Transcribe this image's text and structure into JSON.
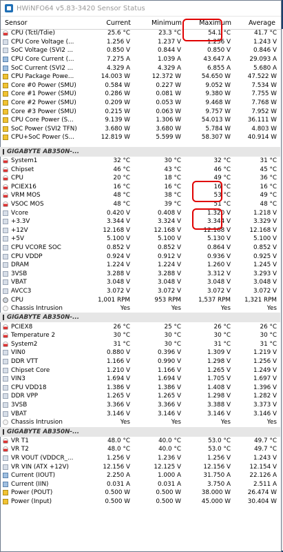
{
  "window": {
    "title": "HWiNFO64 v5.83-3420 Sensor Status"
  },
  "columns": [
    "Sensor",
    "Current",
    "Minimum",
    "Maximum",
    "Average"
  ],
  "rows": [
    {
      "type": "data",
      "icon": "temp",
      "label": "CPU (Tctl/Tdie)",
      "cur": "25.6 °C",
      "min": "23.3 °C",
      "max": "54.1 °C",
      "avg": "41.7 °C"
    },
    {
      "type": "data",
      "icon": "volt",
      "label": "CPU Core Voltage (...",
      "cur": "1.256 V",
      "min": "1.237 V",
      "max": "1.256 V",
      "avg": "1.243 V"
    },
    {
      "type": "data",
      "icon": "volt",
      "label": "SoC Voltage (SVI2 ...",
      "cur": "0.850 V",
      "min": "0.844 V",
      "max": "0.850 V",
      "avg": "0.846 V"
    },
    {
      "type": "data",
      "icon": "current",
      "label": "CPU Core Current (...",
      "cur": "7.275 A",
      "min": "1.039 A",
      "max": "43.647 A",
      "avg": "29.093 A"
    },
    {
      "type": "data",
      "icon": "current",
      "label": "SoC Current (SVI2 ...",
      "cur": "4.329 A",
      "min": "4.329 A",
      "max": "6.855 A",
      "avg": "5.680 A"
    },
    {
      "type": "data",
      "icon": "power",
      "label": "CPU Package Powe...",
      "cur": "14.003 W",
      "min": "12.372 W",
      "max": "54.650 W",
      "avg": "47.522 W"
    },
    {
      "type": "data",
      "icon": "power",
      "label": "Core #0 Power (SMU)",
      "cur": "0.584 W",
      "min": "0.227 W",
      "max": "9.052 W",
      "avg": "7.534 W"
    },
    {
      "type": "data",
      "icon": "power",
      "label": "Core #1 Power (SMU)",
      "cur": "0.286 W",
      "min": "0.081 W",
      "max": "9.380 W",
      "avg": "7.755 W"
    },
    {
      "type": "data",
      "icon": "power",
      "label": "Core #2 Power (SMU)",
      "cur": "0.209 W",
      "min": "0.053 W",
      "max": "9.468 W",
      "avg": "7.768 W"
    },
    {
      "type": "data",
      "icon": "power",
      "label": "Core #3 Power (SMU)",
      "cur": "0.215 W",
      "min": "0.063 W",
      "max": "9.757 W",
      "avg": "7.952 W"
    },
    {
      "type": "data",
      "icon": "power",
      "label": "CPU Core Power (S...",
      "cur": "9.139 W",
      "min": "1.306 W",
      "max": "54.013 W",
      "avg": "36.111 W"
    },
    {
      "type": "data",
      "icon": "power",
      "label": "SoC Power (SVI2 TFN)",
      "cur": "3.680 W",
      "min": "3.680 W",
      "max": "5.784 W",
      "avg": "4.803 W"
    },
    {
      "type": "data",
      "icon": "power",
      "label": "CPU+SoC Power (S...",
      "cur": "12.819 W",
      "min": "5.599 W",
      "max": "58.307 W",
      "avg": "40.914 W"
    },
    {
      "type": "blank"
    },
    {
      "type": "section",
      "label": "GIGABYTE AB350N-..."
    },
    {
      "type": "data",
      "icon": "temp",
      "label": "System1",
      "cur": "32 °C",
      "min": "30 °C",
      "max": "32 °C",
      "avg": "31 °C"
    },
    {
      "type": "data",
      "icon": "temp",
      "label": "Chipset",
      "cur": "46 °C",
      "min": "43 °C",
      "max": "46 °C",
      "avg": "45 °C"
    },
    {
      "type": "data",
      "icon": "temp",
      "label": "CPU",
      "cur": "20 °C",
      "min": "18 °C",
      "max": "49 °C",
      "avg": "36 °C"
    },
    {
      "type": "data",
      "icon": "temp",
      "label": "PCIEX16",
      "cur": "16 °C",
      "min": "16 °C",
      "max": "16 °C",
      "avg": "16 °C"
    },
    {
      "type": "data",
      "icon": "temp",
      "label": "VRM MOS",
      "cur": "48 °C",
      "min": "38 °C",
      "max": "53 °C",
      "avg": "49 °C"
    },
    {
      "type": "data",
      "icon": "temp",
      "label": "VSOC MOS",
      "cur": "48 °C",
      "min": "39 °C",
      "max": "51 °C",
      "avg": "48 °C"
    },
    {
      "type": "data",
      "icon": "volt",
      "label": "Vcore",
      "cur": "0.420 V",
      "min": "0.408 V",
      "max": "1.320 V",
      "avg": "1.218 V"
    },
    {
      "type": "data",
      "icon": "volt",
      "label": "+3.3V",
      "cur": "3.344 V",
      "min": "3.324 V",
      "max": "3.344 V",
      "avg": "3.329 V"
    },
    {
      "type": "data",
      "icon": "volt",
      "label": "+12V",
      "cur": "12.168 V",
      "min": "12.168 V",
      "max": "12.168 V",
      "avg": "12.168 V"
    },
    {
      "type": "data",
      "icon": "volt",
      "label": "+5V",
      "cur": "5.100 V",
      "min": "5.100 V",
      "max": "5.130 V",
      "avg": "5.100 V"
    },
    {
      "type": "data",
      "icon": "volt",
      "label": "CPU VCORE SOC",
      "cur": "0.852 V",
      "min": "0.852 V",
      "max": "0.864 V",
      "avg": "0.852 V"
    },
    {
      "type": "data",
      "icon": "volt",
      "label": "CPU VDDP",
      "cur": "0.924 V",
      "min": "0.912 V",
      "max": "0.936 V",
      "avg": "0.925 V"
    },
    {
      "type": "data",
      "icon": "volt",
      "label": "DRAM",
      "cur": "1.224 V",
      "min": "1.224 V",
      "max": "1.260 V",
      "avg": "1.245 V"
    },
    {
      "type": "data",
      "icon": "volt",
      "label": "3VSB",
      "cur": "3.288 V",
      "min": "3.288 V",
      "max": "3.312 V",
      "avg": "3.293 V"
    },
    {
      "type": "data",
      "icon": "volt",
      "label": "VBAT",
      "cur": "3.048 V",
      "min": "3.048 V",
      "max": "3.048 V",
      "avg": "3.048 V"
    },
    {
      "type": "data",
      "icon": "volt",
      "label": "AVCC3",
      "cur": "3.072 V",
      "min": "3.072 V",
      "max": "3.072 V",
      "avg": "3.072 V"
    },
    {
      "type": "data",
      "icon": "fan",
      "label": "CPU",
      "cur": "1,001 RPM",
      "min": "953 RPM",
      "max": "1,537 RPM",
      "avg": "1,321 RPM"
    },
    {
      "type": "data",
      "icon": "other",
      "label": "Chassis Intrusion",
      "cur": "Yes",
      "min": "Yes",
      "max": "Yes",
      "avg": "Yes"
    },
    {
      "type": "section",
      "label": "GIGABYTE AB350N-..."
    },
    {
      "type": "data",
      "icon": "temp",
      "label": "PCIEX8",
      "cur": "26 °C",
      "min": "25 °C",
      "max": "26 °C",
      "avg": "26 °C"
    },
    {
      "type": "data",
      "icon": "temp",
      "label": "Temperature 2",
      "cur": "30 °C",
      "min": "30 °C",
      "max": "30 °C",
      "avg": "30 °C"
    },
    {
      "type": "data",
      "icon": "temp",
      "label": "System2",
      "cur": "31 °C",
      "min": "30 °C",
      "max": "31 °C",
      "avg": "31 °C"
    },
    {
      "type": "data",
      "icon": "volt",
      "label": "VIN0",
      "cur": "0.880 V",
      "min": "0.396 V",
      "max": "1.309 V",
      "avg": "1.219 V"
    },
    {
      "type": "data",
      "icon": "volt",
      "label": "DDR VTT",
      "cur": "1.166 V",
      "min": "0.990 V",
      "max": "1.298 V",
      "avg": "1.256 V"
    },
    {
      "type": "data",
      "icon": "volt",
      "label": "Chipset Core",
      "cur": "1.210 V",
      "min": "1.166 V",
      "max": "1.265 V",
      "avg": "1.249 V"
    },
    {
      "type": "data",
      "icon": "volt",
      "label": "VIN3",
      "cur": "1.694 V",
      "min": "1.694 V",
      "max": "1.705 V",
      "avg": "1.697 V"
    },
    {
      "type": "data",
      "icon": "volt",
      "label": "CPU VDD18",
      "cur": "1.386 V",
      "min": "1.386 V",
      "max": "1.408 V",
      "avg": "1.396 V"
    },
    {
      "type": "data",
      "icon": "volt",
      "label": "DDR VPP",
      "cur": "1.265 V",
      "min": "1.265 V",
      "max": "1.298 V",
      "avg": "1.282 V"
    },
    {
      "type": "data",
      "icon": "volt",
      "label": "3VSB",
      "cur": "3.366 V",
      "min": "3.366 V",
      "max": "3.388 V",
      "avg": "3.373 V"
    },
    {
      "type": "data",
      "icon": "volt",
      "label": "VBAT",
      "cur": "3.146 V",
      "min": "3.146 V",
      "max": "3.146 V",
      "avg": "3.146 V"
    },
    {
      "type": "data",
      "icon": "other",
      "label": "Chassis Intrusion",
      "cur": "Yes",
      "min": "Yes",
      "max": "Yes",
      "avg": "Yes"
    },
    {
      "type": "section",
      "label": "GIGABYTE AB350N-..."
    },
    {
      "type": "data",
      "icon": "temp",
      "label": "VR T1",
      "cur": "48.0 °C",
      "min": "40.0 °C",
      "max": "53.0 °C",
      "avg": "49.7 °C"
    },
    {
      "type": "data",
      "icon": "temp",
      "label": "VR T2",
      "cur": "48.0 °C",
      "min": "40.0 °C",
      "max": "53.0 °C",
      "avg": "49.7 °C"
    },
    {
      "type": "data",
      "icon": "volt",
      "label": "VR VOUT (VDDCR_...",
      "cur": "1.256 V",
      "min": "1.236 V",
      "max": "1.256 V",
      "avg": "1.243 V"
    },
    {
      "type": "data",
      "icon": "volt",
      "label": "VR VIN (ATX +12V)",
      "cur": "12.156 V",
      "min": "12.125 V",
      "max": "12.156 V",
      "avg": "12.154 V"
    },
    {
      "type": "data",
      "icon": "current",
      "label": "Current (IOUT)",
      "cur": "2.250 A",
      "min": "1.000 A",
      "max": "31.750 A",
      "avg": "22.126 A"
    },
    {
      "type": "data",
      "icon": "current",
      "label": "Current (IIN)",
      "cur": "0.031 A",
      "min": "0.031 A",
      "max": "3.750 A",
      "avg": "2.511 A"
    },
    {
      "type": "data",
      "icon": "power",
      "label": "Power (POUT)",
      "cur": "0.500 W",
      "min": "0.500 W",
      "max": "38.000 W",
      "avg": "26.474 W"
    },
    {
      "type": "data",
      "icon": "power",
      "label": "Power (Input)",
      "cur": "0.500 W",
      "min": "0.500 W",
      "max": "45.000 W",
      "avg": "30.404 W"
    }
  ]
}
